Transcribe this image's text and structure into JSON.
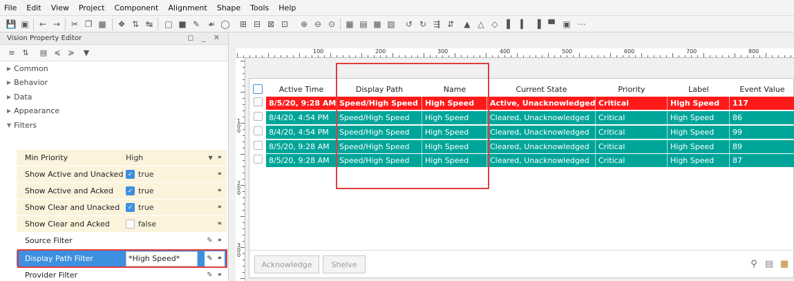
{
  "menu": [
    "File",
    "Edit",
    "View",
    "Project",
    "Component",
    "Alignment",
    "Shape",
    "Tools",
    "Help"
  ],
  "property_editor": {
    "title": "Vision Property Editor",
    "sections": {
      "common": "Common",
      "behavior": "Behavior",
      "data": "Data",
      "appearance": "Appearance",
      "filters": "Filters"
    },
    "rows": [
      {
        "name": "Min Priority",
        "value": "High"
      },
      {
        "name": "Show Active and Unacked",
        "value": "true",
        "checked": true
      },
      {
        "name": "Show Active and Acked",
        "value": "true",
        "checked": true
      },
      {
        "name": "Show Clear and Unacked",
        "value": "true",
        "checked": true
      },
      {
        "name": "Show Clear and Acked",
        "value": "false",
        "checked": false
      },
      {
        "name": "Source Filter",
        "value": ""
      },
      {
        "name": "Display Path Filter",
        "value": "*High Speed*"
      },
      {
        "name": "Provider Filter",
        "value": ""
      }
    ]
  },
  "ruler": {
    "top_labels": [
      "100",
      "200",
      "300",
      "400",
      "500",
      "600",
      "700",
      "800"
    ],
    "left_labels": [
      "1\n0\n0",
      "2\n0\n0",
      "3\n0\n0"
    ]
  },
  "alarm_table": {
    "columns": [
      "Active Time",
      "Display Path",
      "Name",
      "Current State",
      "Priority",
      "Label",
      "Event Value"
    ],
    "rows": [
      {
        "active_time": "8/5/20, 9:28 AM",
        "display_path": "Speed/High Speed",
        "name": "High Speed",
        "state": "Active, Unacknowledged",
        "priority": "Critical",
        "label": "High Speed",
        "value": "117",
        "status": "active"
      },
      {
        "active_time": "8/4/20, 4:54 PM",
        "display_path": "Speed/High Speed",
        "name": "High Speed",
        "state": "Cleared, Unacknowledged",
        "priority": "Critical",
        "label": "High Speed",
        "value": "86",
        "status": "cleared"
      },
      {
        "active_time": "8/4/20, 4:54 PM",
        "display_path": "Speed/High Speed",
        "name": "High Speed",
        "state": "Cleared, Unacknowledged",
        "priority": "Critical",
        "label": "High Speed",
        "value": "99",
        "status": "cleared"
      },
      {
        "active_time": "8/5/20, 9:28 AM",
        "display_path": "Speed/High Speed",
        "name": "High Speed",
        "state": "Cleared, Unacknowledged",
        "priority": "Critical",
        "label": "High Speed",
        "value": "89",
        "status": "cleared"
      },
      {
        "active_time": "8/5/20, 9:28 AM",
        "display_path": "Speed/High Speed",
        "name": "High Speed",
        "state": "Cleared, Unacknowledged",
        "priority": "Critical",
        "label": "High Speed",
        "value": "87",
        "status": "cleared"
      }
    ],
    "buttons": {
      "acknowledge": "Acknowledge",
      "shelve": "Shelve"
    }
  },
  "colors": {
    "active_row": "#ff1a1a",
    "cleared_row": "#00a59a",
    "selection": "#3d8fe0",
    "highlight": "#e23b3b"
  },
  "icons": [
    "search-icon",
    "notes-icon",
    "shelf-icon"
  ]
}
